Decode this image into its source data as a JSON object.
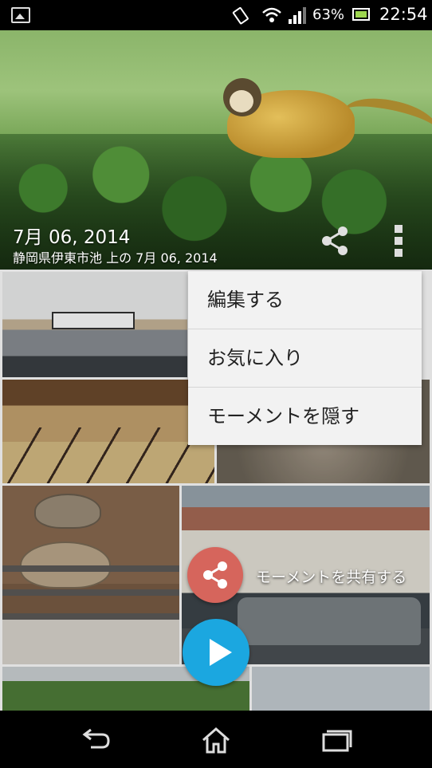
{
  "status_bar": {
    "battery": "63%",
    "time": "22:54",
    "icons": [
      "gallery-notification-icon",
      "screen-rotation-icon",
      "wifi-icon",
      "signal-icon",
      "battery-icon"
    ],
    "battery_color": "#9ed64f"
  },
  "hero": {
    "date": "7月 06, 2014",
    "place": "静岡県伊東市池 上の 7月 06, 2014",
    "share_icon": "share-icon",
    "overflow_icon": "overflow-menu-icon"
  },
  "menu": {
    "items": [
      {
        "label": "編集する"
      },
      {
        "label": "お気に入り"
      },
      {
        "label": "モーメントを隠す"
      }
    ]
  },
  "fab": {
    "share_label": "モーメントを共有する",
    "share_color": "#d6655c",
    "play_color": "#1ba7e0"
  },
  "nav_bar": {
    "icons": [
      "back-icon",
      "home-icon",
      "recent-apps-icon"
    ]
  }
}
